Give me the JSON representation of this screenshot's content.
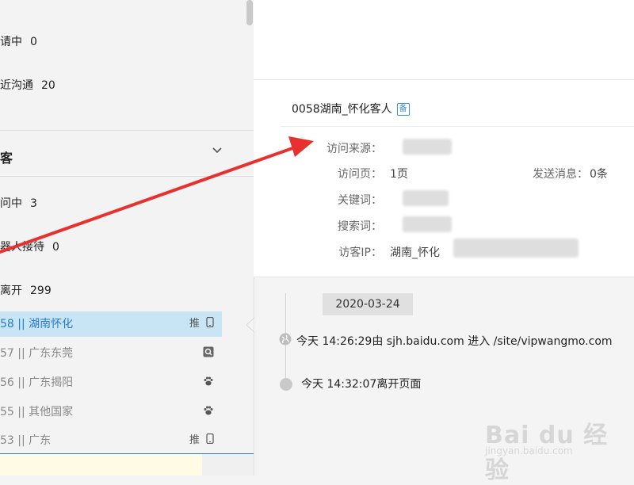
{
  "sidebar": {
    "stats": [
      {
        "label": "请中",
        "count": "0"
      },
      {
        "label": "近沟通",
        "count": "20"
      }
    ],
    "group": {
      "title": "客"
    },
    "status_rows": [
      {
        "label": "问中",
        "count": "3"
      },
      {
        "label": "器人接待",
        "count": "0"
      },
      {
        "label": "离开",
        "count": "299"
      }
    ],
    "visitors": [
      {
        "label": "58 || 湖南怀化",
        "tag": "推",
        "icon": "mobile-icon",
        "selected": true
      },
      {
        "label": "57 || 广东东莞",
        "tag": "",
        "icon": "search-engine-icon",
        "selected": false
      },
      {
        "label": "56 || 广东揭阳",
        "tag": "",
        "icon": "paw-icon",
        "selected": false
      },
      {
        "label": "55 || 其他国家",
        "tag": "",
        "icon": "paw-icon",
        "selected": false
      },
      {
        "label": "53 || 广东",
        "tag": "推",
        "icon": "mobile-icon",
        "selected": false
      }
    ]
  },
  "card": {
    "title": "0058湖南_怀化客人",
    "badge": "备",
    "fields": {
      "source_label": "访问来源：",
      "pages_label": "访问页：",
      "pages_value": "1页",
      "messages_label": "发送消息：",
      "messages_value": "0条",
      "keyword_label": "关键词：",
      "search_label": "搜索词：",
      "ip_label": "访客IP：",
      "ip_value": "湖南_怀化"
    }
  },
  "timeline": {
    "date": "2020-03-24",
    "events": [
      {
        "text": "今天 14:26:29由 sjh.baidu.com 进入 /site/vipwangmo.com",
        "icon": "globe-icon"
      },
      {
        "text": "今天 14:32:07离开页面",
        "icon": "dot-icon"
      }
    ]
  },
  "watermark": {
    "main": "Bai du 经验",
    "sub": "jingyan.baidu.com"
  },
  "colors": {
    "accent": "#2a79c9",
    "selected_bg": "#c8e5f6",
    "arrow": "#e8312f"
  }
}
